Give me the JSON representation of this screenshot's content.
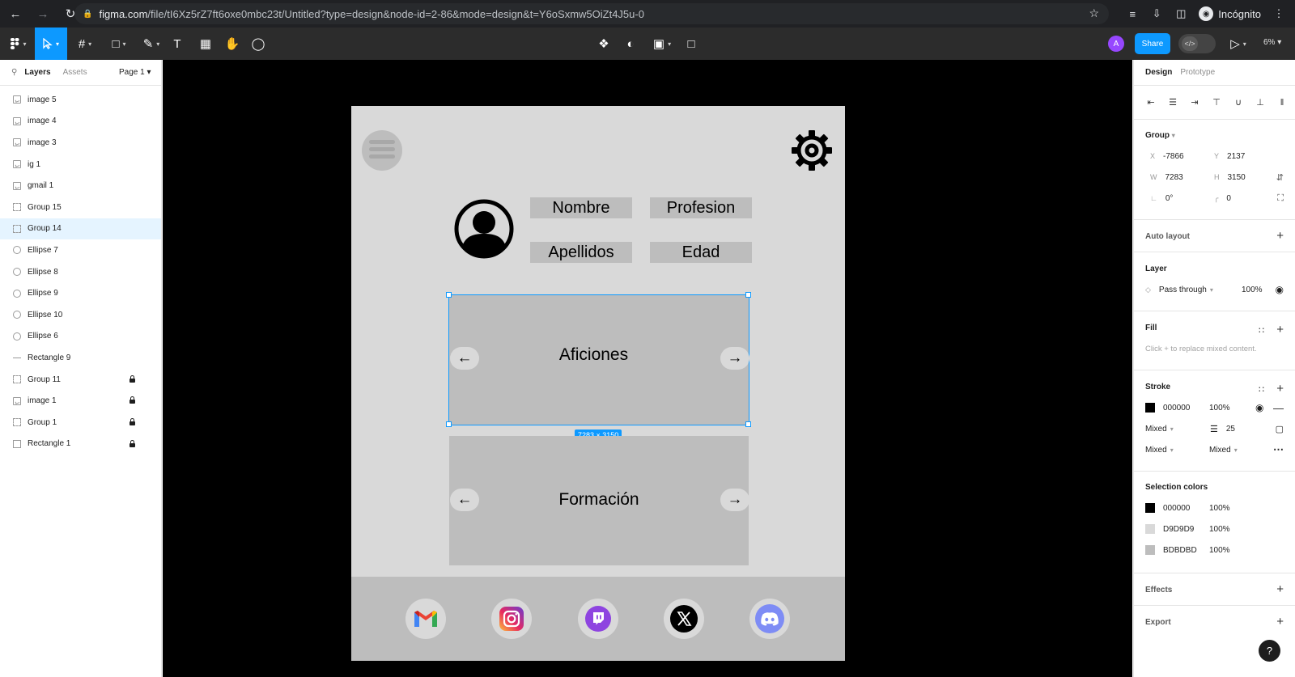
{
  "browser": {
    "url_host": "figma.com",
    "url_path": "/file/tI6Xz5rZ7ft6oxe0mbc23t/Untitled?type=design&node-id=2-86&mode=design&t=Y6oSxmw5OiZt4J5u-0",
    "profile_label": "Incógnito",
    "icons": [
      "back-arrow-icon",
      "forward-arrow-icon",
      "reload-icon",
      "lock-icon",
      "star-icon",
      "reading-list-icon",
      "download-icon",
      "side-panel-icon",
      "incognito-icon",
      "more-icon"
    ]
  },
  "toolbar": {
    "avatar_initial": "A",
    "share_label": "Share",
    "zoom_label": "6%",
    "icons": [
      "figma-menu-icon",
      "move-tool-icon",
      "frame-tool-icon",
      "shape-tool-icon",
      "pen-tool-icon",
      "text-tool-icon",
      "resources-icon",
      "hand-tool-icon",
      "comment-icon",
      "component-icon",
      "mask-icon",
      "boolean-icon",
      "crop-icon",
      "dev-mode-icon",
      "present-icon"
    ]
  },
  "left_panel": {
    "tabs": [
      "Layers",
      "Assets"
    ],
    "active_tab": "Layers",
    "page_label": "Page 1",
    "layers": [
      {
        "name": "image 5",
        "type": "image",
        "locked": false,
        "selected": false
      },
      {
        "name": "image 4",
        "type": "image",
        "locked": false,
        "selected": false
      },
      {
        "name": "image 3",
        "type": "image",
        "locked": false,
        "selected": false
      },
      {
        "name": "ig 1",
        "type": "image",
        "locked": false,
        "selected": false
      },
      {
        "name": "gmail 1",
        "type": "image",
        "locked": false,
        "selected": false
      },
      {
        "name": "Group 15",
        "type": "group",
        "locked": false,
        "selected": false
      },
      {
        "name": "Group 14",
        "type": "group",
        "locked": false,
        "selected": true
      },
      {
        "name": "Ellipse 7",
        "type": "ellipse",
        "locked": false,
        "selected": false
      },
      {
        "name": "Ellipse 8",
        "type": "ellipse",
        "locked": false,
        "selected": false
      },
      {
        "name": "Ellipse 9",
        "type": "ellipse",
        "locked": false,
        "selected": false
      },
      {
        "name": "Ellipse 10",
        "type": "ellipse",
        "locked": false,
        "selected": false
      },
      {
        "name": "Ellipse 6",
        "type": "ellipse",
        "locked": false,
        "selected": false
      },
      {
        "name": "Rectangle 9",
        "type": "line",
        "locked": false,
        "selected": false
      },
      {
        "name": "Group 11",
        "type": "group",
        "locked": true,
        "selected": false
      },
      {
        "name": "image 1",
        "type": "image",
        "locked": true,
        "selected": false
      },
      {
        "name": "Group 1",
        "type": "group",
        "locked": true,
        "selected": false
      },
      {
        "name": "Rectangle 1",
        "type": "rect",
        "locked": true,
        "selected": false
      }
    ]
  },
  "canvas": {
    "fields": [
      "Nombre",
      "Profesion",
      "Apellidos",
      "Edad"
    ],
    "carousel1_label": "Aficiones",
    "carousel2_label": "Formación",
    "selection_size": "7283 × 3150",
    "social_icons": [
      "gmail-icon",
      "instagram-icon",
      "twitch-icon",
      "x-icon",
      "discord-icon"
    ],
    "colors": {
      "frame": "#D9D9D9",
      "block": "#BDBDBD",
      "stroke": "#000000",
      "selection": "#0D99FF"
    }
  },
  "right_panel": {
    "tabs": [
      "Design",
      "Prototype"
    ],
    "active_tab": "Design",
    "group_title": "Group",
    "x_label": "X",
    "x_value": "-7866",
    "y_label": "Y",
    "y_value": "2137",
    "w_label": "W",
    "w_value": "7283",
    "h_label": "H",
    "h_value": "3150",
    "rotation_value": "0°",
    "radius_value": "0",
    "auto_layout_title": "Auto layout",
    "layer_title": "Layer",
    "blend_mode": "Pass through",
    "layer_opacity": "100%",
    "fill_title": "Fill",
    "fill_hint": "Click + to replace mixed content.",
    "stroke_title": "Stroke",
    "stroke_color": "000000",
    "stroke_opacity": "100%",
    "stroke_position": "Mixed",
    "stroke_weight": "25",
    "stroke_sides": "Mixed",
    "stroke_style": "Mixed",
    "selection_colors_title": "Selection colors",
    "selection_colors": [
      {
        "hex": "000000",
        "opacity": "100%"
      },
      {
        "hex": "D9D9D9",
        "opacity": "100%"
      },
      {
        "hex": "BDBDBD",
        "opacity": "100%"
      }
    ],
    "effects_title": "Effects",
    "export_title": "Export"
  },
  "help_label": "?"
}
